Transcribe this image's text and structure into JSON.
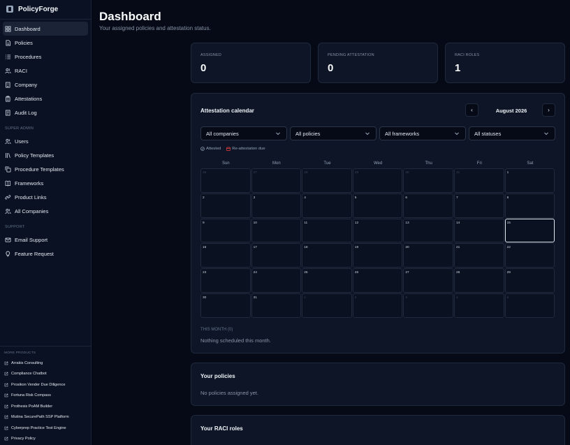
{
  "app": {
    "name": "PolicyForge"
  },
  "sidebar": {
    "main_items": [
      {
        "label": "Dashboard",
        "icon": "grid-icon",
        "active": true
      },
      {
        "label": "Policies",
        "icon": "document-icon"
      },
      {
        "label": "Procedures",
        "icon": "list-icon"
      },
      {
        "label": "RACI",
        "icon": "users-icon"
      },
      {
        "label": "Company",
        "icon": "building-icon"
      },
      {
        "label": "Attestations",
        "icon": "clipboard-icon"
      },
      {
        "label": "Audit Log",
        "icon": "log-icon"
      }
    ],
    "super_admin_label": "SUPER ADMIN",
    "admin_items": [
      {
        "label": "Users",
        "icon": "users-icon"
      },
      {
        "label": "Policy Templates",
        "icon": "library-icon"
      },
      {
        "label": "Procedure Templates",
        "icon": "copy-icon"
      },
      {
        "label": "Frameworks",
        "icon": "book-icon"
      },
      {
        "label": "Product Links",
        "icon": "link-icon"
      },
      {
        "label": "All Companies",
        "icon": "users-icon"
      }
    ],
    "support_label": "SUPPORT",
    "support_items": [
      {
        "label": "Email Support",
        "icon": "mail-icon"
      },
      {
        "label": "Feature Request",
        "icon": "lightbulb-icon"
      }
    ],
    "more_label": "MORE PRODUCTS",
    "more_products": [
      "Arrakis Consulting",
      "Compliance Chatbot",
      "Prosikon Vender Due Diligence",
      "Fortuna Risk Compass",
      "Prothesis PoAM Builder",
      "Mutina SecurePath SSP Platform",
      "Cyberprep Practice Test Engine",
      "Privacy Policy"
    ]
  },
  "header": {
    "title": "Dashboard",
    "subtitle": "Your assigned policies and attestation status."
  },
  "stats": [
    {
      "label": "ASSIGNED",
      "value": "0"
    },
    {
      "label": "PENDING ATTESTATION",
      "value": "0"
    },
    {
      "label": "RACI ROLES",
      "value": "1"
    }
  ],
  "calendar": {
    "title": "Attestation calendar",
    "month": "August 2026",
    "prev_glyph": "‹",
    "next_glyph": "›",
    "filters": [
      "All companies",
      "All policies",
      "All frameworks",
      "All statuses"
    ],
    "legend_attested": "Attested",
    "legend_due": "Re-attestation due",
    "weekdays": [
      "Sun",
      "Mon",
      "Tue",
      "Wed",
      "Thu",
      "Fri",
      "Sat"
    ],
    "days": [
      "26",
      "27",
      "28",
      "29",
      "30",
      "31",
      "1",
      "2",
      "3",
      "4",
      "5",
      "6",
      "7",
      "8",
      "9",
      "10",
      "11",
      "12",
      "13",
      "14",
      "15",
      "16",
      "17",
      "18",
      "19",
      "20",
      "21",
      "22",
      "23",
      "24",
      "25",
      "26",
      "27",
      "28",
      "29",
      "30",
      "31",
      "1",
      "2",
      "3",
      "4",
      "5"
    ],
    "outside_leading": 6,
    "outside_trailing_start": 37,
    "today_index": 20,
    "month_count_label": "THIS MONTH (0)",
    "month_empty": "Nothing scheduled this month."
  },
  "policies": {
    "title": "Your policies",
    "empty": "No policies assigned yet."
  },
  "raci": {
    "title": "Your RACI roles"
  }
}
